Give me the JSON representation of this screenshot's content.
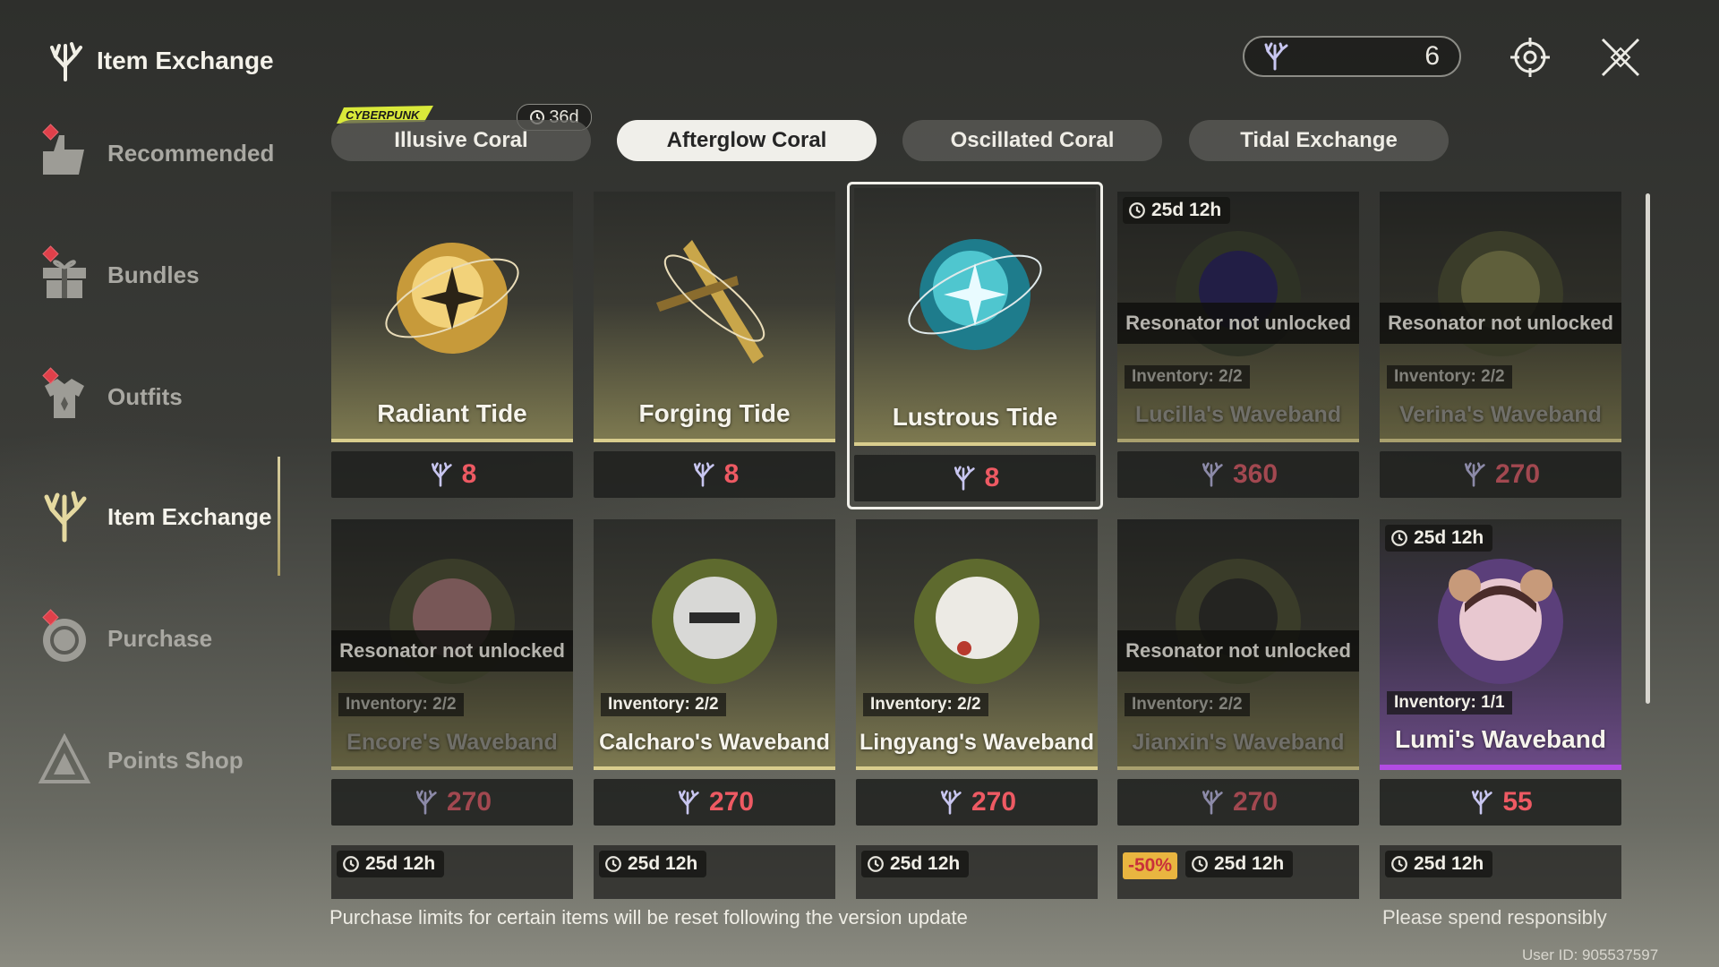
{
  "header": {
    "title": "Item Exchange",
    "currency_amount": "6"
  },
  "sidebar": {
    "items": [
      {
        "label": "Recommended",
        "icon": "recommended-icon",
        "alert": true
      },
      {
        "label": "Bundles",
        "icon": "gift-icon",
        "alert": true
      },
      {
        "label": "Outfits",
        "icon": "outfit-icon",
        "alert": true
      },
      {
        "label": "Item Exchange",
        "icon": "coral-icon",
        "alert": false,
        "active": true
      },
      {
        "label": "Purchase",
        "icon": "purchase-icon",
        "alert": true
      },
      {
        "label": "Points Shop",
        "icon": "points-icon",
        "alert": false
      }
    ]
  },
  "tabs": [
    {
      "label": "Illusive Coral",
      "badge": "36d",
      "logo": "CYBERPUNK"
    },
    {
      "label": "Afterglow Coral",
      "active": true
    },
    {
      "label": "Oscillated Coral"
    },
    {
      "label": "Tidal Exchange"
    }
  ],
  "items": [
    {
      "name": "Radiant Tide",
      "price": "8"
    },
    {
      "name": "Forging Tide",
      "price": "8"
    },
    {
      "name": "Lustrous Tide",
      "price": "8",
      "selected": true
    },
    {
      "name": "Lucilla's Waveband",
      "price": "360",
      "timer": "25d 12h",
      "lock": "Resonator not unlocked",
      "inventory": "Inventory: 2/2"
    },
    {
      "name": "Verina's Waveband",
      "price": "270",
      "lock": "Resonator not unlocked",
      "inventory": "Inventory: 2/2"
    },
    {
      "name": "Encore's Waveband",
      "price": "270",
      "lock": "Resonator not unlocked",
      "inventory": "Inventory: 2/2"
    },
    {
      "name": "Calcharo's Waveband",
      "price": "270",
      "inventory": "Inventory: 2/2"
    },
    {
      "name": "Lingyang's Waveband",
      "price": "270",
      "inventory": "Inventory: 2/2"
    },
    {
      "name": "Jianxin's Waveband",
      "price": "270",
      "lock": "Resonator not unlocked",
      "inventory": "Inventory: 2/2"
    },
    {
      "name": "Lumi's Waveband",
      "price": "55",
      "timer": "25d 12h",
      "inventory": "Inventory: 1/1"
    }
  ],
  "partial_row": [
    {
      "timer": "25d 12h"
    },
    {
      "timer": "25d 12h"
    },
    {
      "timer": "25d 12h"
    },
    {
      "timer": "25d 12h",
      "discount": "-50%"
    },
    {
      "timer": "25d 12h"
    }
  ],
  "footer": {
    "note": "Purchase limits for certain items will be reset following the version update",
    "right": "Please spend responsibly",
    "user_id": "User ID: 905537597"
  },
  "colors": {
    "price_red": "#ee5a63",
    "accent_gold": "#d9cd8d",
    "purple": "#b14ce3",
    "discount_bg": "#e9b540"
  }
}
